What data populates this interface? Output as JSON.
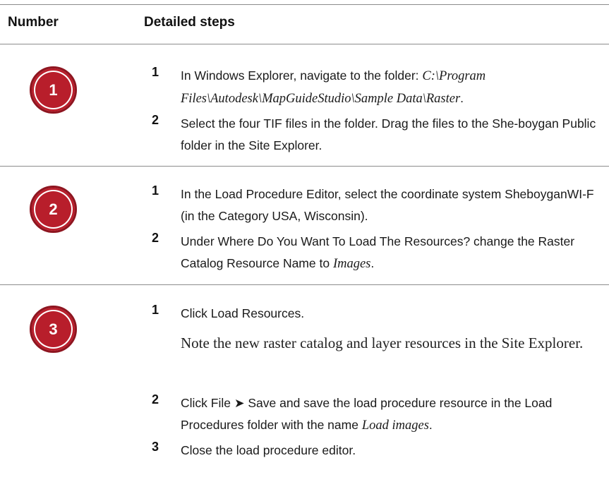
{
  "header": {
    "col_number": "Number",
    "col_steps": "Detailed steps"
  },
  "rows": [
    {
      "number": "1",
      "steps": [
        {
          "n": "1",
          "a": "In Windows Explorer, navigate to the folder: ",
          "i": "C:\\Program Files\\Autodesk\\MapGuideStudio\\Sample Data\\Raster",
          "b": "."
        },
        {
          "n": "2",
          "a": "Select the four TIF files in the folder. Drag the files to the She-boygan Public folder in the Site Explorer."
        }
      ]
    },
    {
      "number": "2",
      "steps": [
        {
          "n": "1",
          "a": "In the Load Procedure Editor, select the coordinate system SheboyganWI-F (in the Category USA, Wisconsin)."
        },
        {
          "n": "2",
          "a": "Under Where Do You Want To Load The Resources? change the Raster Catalog Resource Name to ",
          "i": "Images",
          "b": "."
        }
      ]
    },
    {
      "number": "3",
      "steps": [
        {
          "n": "1",
          "a": "Click Load Resources."
        },
        {
          "note": "Note the new raster catalog and layer resources in the Site Explorer."
        },
        {
          "n": "2",
          "a": "Click File ➤ Save and save the load procedure resource in the Load Procedures folder with the name ",
          "i": "Load images",
          "b": "."
        },
        {
          "n": "3",
          "a": "Close the load procedure editor."
        }
      ]
    }
  ]
}
